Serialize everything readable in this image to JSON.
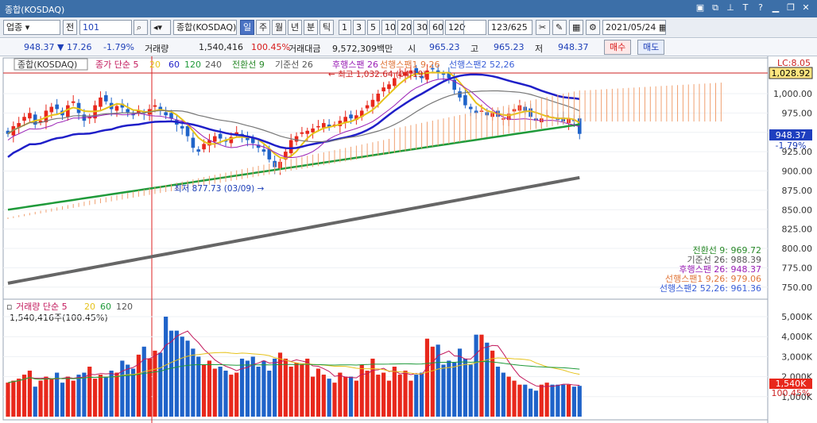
{
  "window": {
    "title": "종합(KOSDAQ)",
    "icons": [
      "window-icon",
      "link-icon",
      "pin-icon",
      "text-icon",
      "help-icon",
      "minimize-icon",
      "restore-icon",
      "close-icon"
    ]
  },
  "toolbar": {
    "market": "업종",
    "all_label": "전",
    "code": "101",
    "index_name": "종합(KOSDAQ)",
    "periods": [
      "일",
      "주",
      "월",
      "년",
      "분",
      "틱"
    ],
    "selected_period": "일",
    "minutes": [
      "1",
      "3",
      "5",
      "10",
      "20",
      "30",
      "60",
      "120"
    ],
    "count": "123/625",
    "date": "2021/05/24"
  },
  "quote": {
    "price": "948.37",
    "change": "17.26",
    "change_pct": "-1.79%",
    "volume_label": "거래량",
    "volume": "1,540,416",
    "volume_pct": "100.45%",
    "amount_label": "거래대금",
    "amount": "9,572,309백만",
    "open_label": "시",
    "open": "965.23",
    "high_label": "고",
    "high": "965.23",
    "low_label": "저",
    "low": "948.37",
    "buy_label": "매수",
    "sell_label": "매도"
  },
  "legend": {
    "index": "종합(KOSDAQ)",
    "ma": "종가 단순 5",
    "ma20": "20",
    "ma60": "60",
    "ma120": "120",
    "ma240": "240",
    "ichimoku": "전환선 9",
    "kijun": "기준선 26",
    "chikou": "후행스팬 26",
    "span1": "선행스팬1 9,26",
    "span2": "선행스팬2 52,26",
    "lc": "LC:8.05"
  },
  "annotations": {
    "high": "최고 1,032.64 (04/19)",
    "low": "최저 877.73 (03/09)"
  },
  "ichimoku_values": [
    {
      "label": "전환선 9: 969.72",
      "color": "#2a8a2a"
    },
    {
      "label": "기준선 26: 988.39",
      "color": "#555555"
    },
    {
      "label": "후행스팬 26: 948.37",
      "color": "#9a1fb5"
    },
    {
      "label": "선행스팬1 9,26: 979.06",
      "color": "#e0763a"
    },
    {
      "label": "선행스팬2 52,26: 961.36",
      "color": "#3a5fd8"
    }
  ],
  "price_axis": {
    "ticks": [
      "1,000.00",
      "975.00",
      "950.00",
      "925.00",
      "900.00",
      "875.00",
      "850.00",
      "825.00",
      "800.00",
      "775.00",
      "750.00"
    ],
    "marker_price": "1,028.92",
    "current": "948.37",
    "current_pct": "-1.79%"
  },
  "volume_panel": {
    "legend": "거래량 단순 5",
    "ma20": "20",
    "ma60": "60",
    "ma120": "120",
    "current": "1,540,416주(100.45%)",
    "ticks": [
      "5,000K",
      "4,000K",
      "3,000K",
      "2,000K",
      "1,000K"
    ],
    "marker": "1,540K",
    "marker_pct": "100.45%"
  },
  "colors": {
    "up": "#e8281c",
    "down": "#1f63c9",
    "ma5": "#e6c21a",
    "ma20": "#1f1fc8",
    "ma60": "#1f9a3a",
    "ma120": "#666666"
  },
  "chart_data": {
    "type": "candlestick",
    "start_price": 948,
    "volume_unit": "K",
    "volumes": [
      1700,
      1800,
      1900,
      2100,
      2300,
      1500,
      1800,
      2000,
      1900,
      2200,
      1700,
      2000,
      1800,
      2100,
      2200,
      2500,
      1900,
      2100,
      2000,
      2300,
      2200,
      2800,
      2600,
      2400,
      3100,
      3500,
      2900,
      3300,
      3200,
      5000,
      4300,
      4300,
      4000,
      3800,
      3400,
      3000,
      2600,
      2800,
      2400,
      2500,
      2300,
      2100,
      2200,
      2900,
      2800,
      3000,
      2500,
      2800,
      2300,
      2900,
      3200,
      2900,
      2500,
      2700,
      2600,
      2900,
      2000,
      2400,
      2100,
      1900,
      1700,
      2200,
      2000,
      2000,
      1800,
      2600,
      2300,
      2900,
      2100,
      2200,
      1800,
      2500,
      2100,
      2300,
      1800,
      2100,
      2200,
      3900,
      3500,
      3600,
      2600,
      2800,
      2700,
      3400,
      2900,
      2600,
      4100,
      4100,
      3700,
      3300,
      2500,
      2200,
      2000,
      1800,
      1600,
      1600,
      1400,
      1300,
      1600,
      1700,
      1600,
      1600,
      1600,
      1600,
      1500,
      1540
    ]
  }
}
